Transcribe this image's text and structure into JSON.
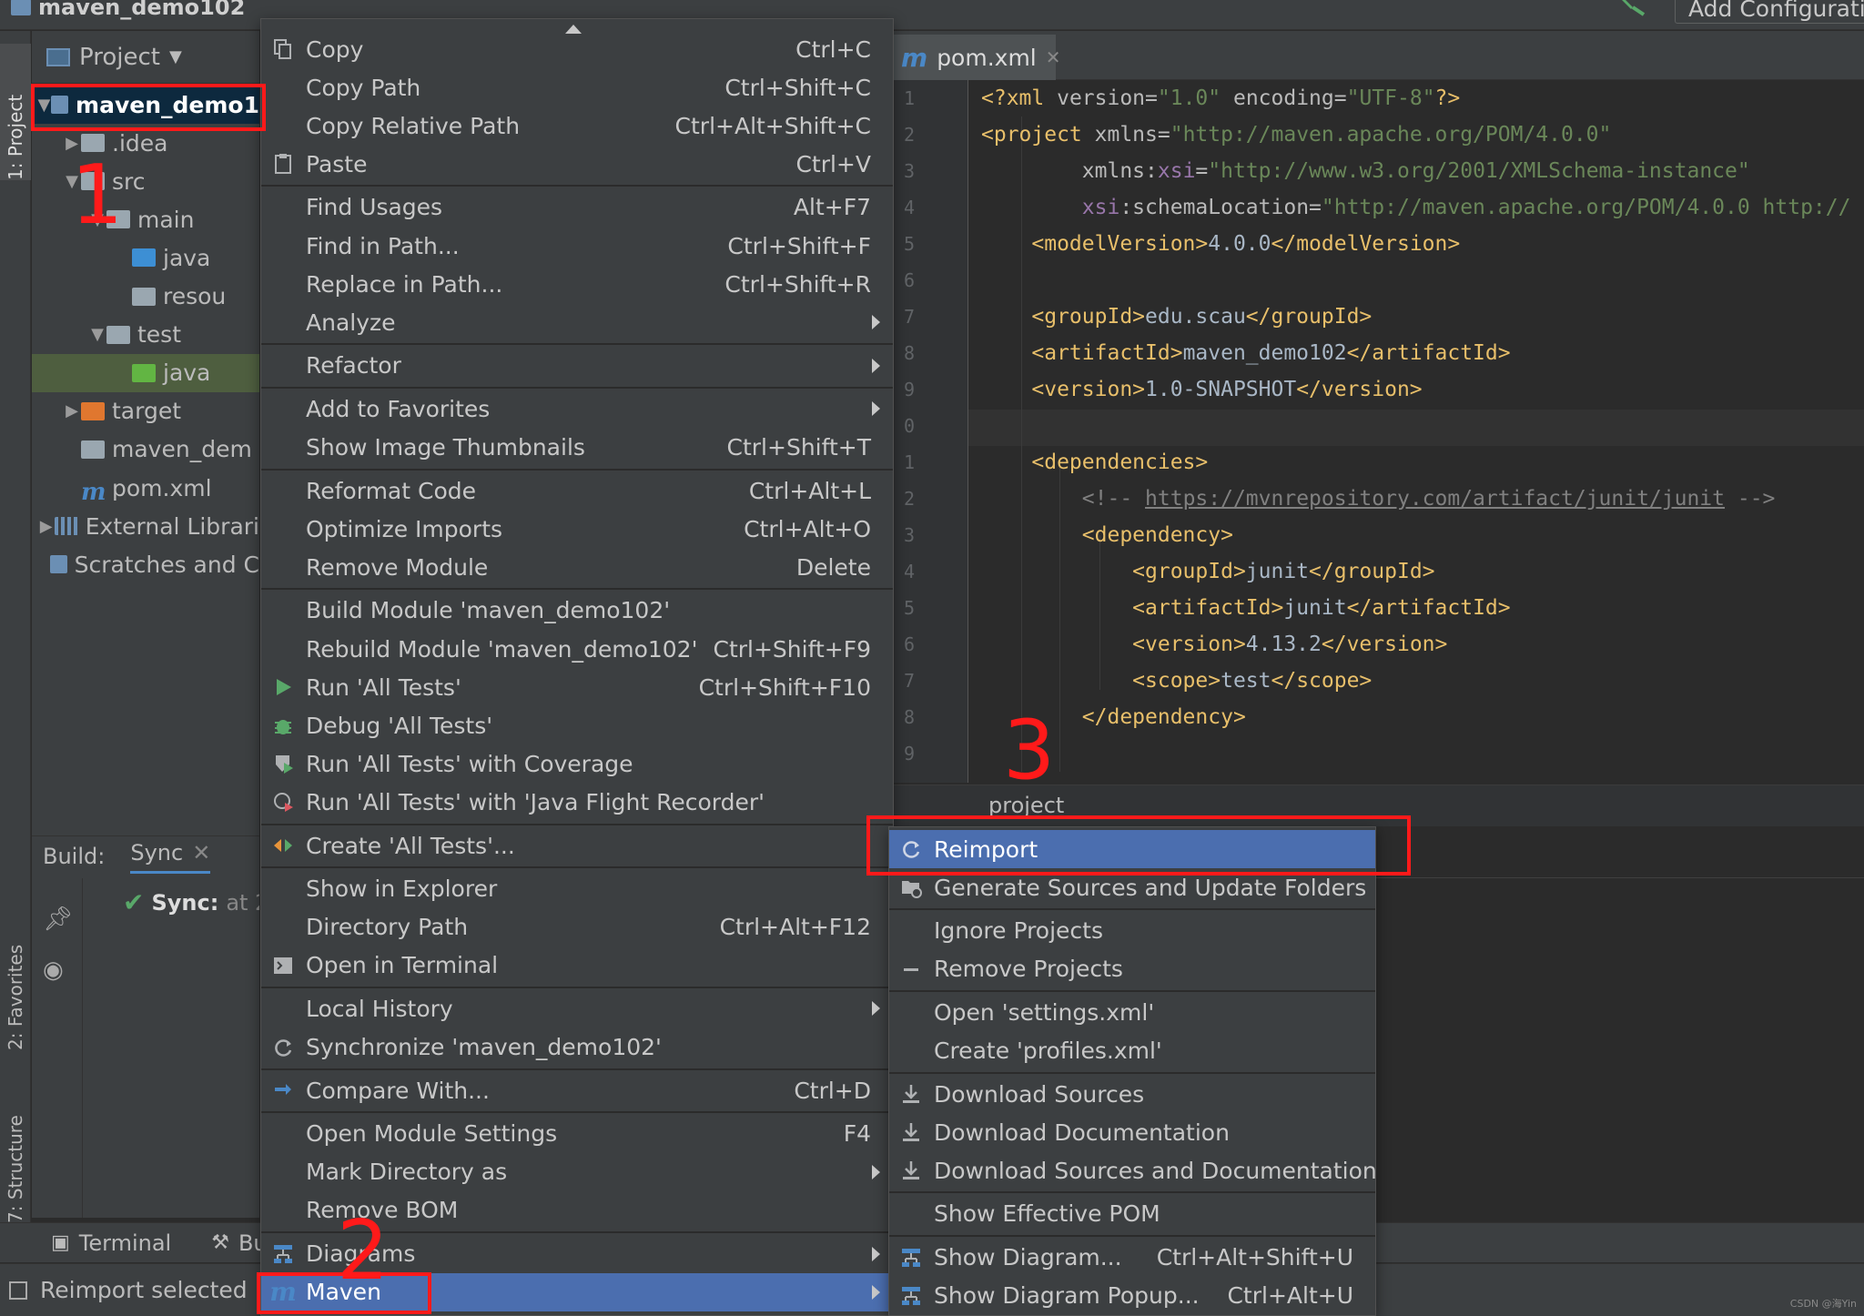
{
  "app": {
    "project_title": "maven_demo102",
    "add_config_label": "Add Configuratio"
  },
  "left_strip": {
    "project_tab": "1: Project",
    "favorites_tab": "2: Favorites",
    "structure_tab": "7: Structure"
  },
  "project_panel": {
    "header": "Project",
    "tree": [
      {
        "label": "maven_demo1",
        "indent": 0,
        "arrow": "▼",
        "icon": "module-folder-icon",
        "selected": true
      },
      {
        "label": ".idea",
        "indent": 1,
        "arrow": "▶",
        "icon": "folder-icon"
      },
      {
        "label": "src",
        "indent": 1,
        "arrow": "▼",
        "icon": "folder-icon"
      },
      {
        "label": "main",
        "indent": 2,
        "arrow": "▼",
        "icon": "folder-icon"
      },
      {
        "label": "java",
        "indent": 3,
        "arrow": "",
        "icon": "source-folder-icon"
      },
      {
        "label": "resou",
        "indent": 3,
        "arrow": "",
        "icon": "resources-folder-icon"
      },
      {
        "label": "test",
        "indent": 2,
        "arrow": "▼",
        "icon": "folder-icon"
      },
      {
        "label": "java",
        "indent": 3,
        "arrow": "",
        "icon": "test-folder-icon",
        "highlight": true
      },
      {
        "label": "target",
        "indent": 1,
        "arrow": "▶",
        "icon": "excluded-folder-icon"
      },
      {
        "label": "maven_dem",
        "indent": 1,
        "arrow": "",
        "icon": "iml-file-icon"
      },
      {
        "label": "pom.xml",
        "indent": 1,
        "arrow": "",
        "icon": "maven-file-icon"
      },
      {
        "label": "External Librari",
        "indent": 0,
        "arrow": "▶",
        "icon": "libraries-icon"
      },
      {
        "label": "Scratches and C",
        "indent": 0,
        "arrow": "",
        "icon": "scratches-icon"
      }
    ]
  },
  "build_panel": {
    "label": "Build:",
    "tab": "Sync",
    "sync_label": "Sync:",
    "sync_text": "at 2"
  },
  "bottom_bar": {
    "terminal": "Terminal",
    "build": "Bu"
  },
  "status_bar": {
    "text": "Reimport selected M"
  },
  "editor": {
    "tab_label": "pom.xml",
    "line_numbers": [
      "1",
      "2",
      "3",
      "4",
      "5",
      "6",
      "7",
      "8",
      "9",
      "0",
      "1",
      "2",
      "3",
      "4",
      "5",
      "6",
      "7",
      "8",
      "9"
    ],
    "breadcrumb": "project"
  },
  "context_menu": {
    "items": [
      {
        "label": "Copy",
        "shortcut": "Ctrl+C",
        "icon": "copy-icon"
      },
      {
        "label": "Copy Path",
        "shortcut": "Ctrl+Shift+C"
      },
      {
        "label": "Copy Relative Path",
        "shortcut": "Ctrl+Alt+Shift+C"
      },
      {
        "label": "Paste",
        "shortcut": "Ctrl+V",
        "icon": "paste-icon",
        "sep_after": true
      },
      {
        "label": "Find Usages",
        "shortcut": "Alt+F7"
      },
      {
        "label": "Find in Path...",
        "shortcut": "Ctrl+Shift+F"
      },
      {
        "label": "Replace in Path...",
        "shortcut": "Ctrl+Shift+R"
      },
      {
        "label": "Analyze",
        "submenu": true,
        "sep_after": true
      },
      {
        "label": "Refactor",
        "submenu": true,
        "sep_after": true
      },
      {
        "label": "Add to Favorites",
        "submenu": true
      },
      {
        "label": "Show Image Thumbnails",
        "shortcut": "Ctrl+Shift+T",
        "sep_after": true
      },
      {
        "label": "Reformat Code",
        "shortcut": "Ctrl+Alt+L"
      },
      {
        "label": "Optimize Imports",
        "shortcut": "Ctrl+Alt+O"
      },
      {
        "label": "Remove Module",
        "shortcut": "Delete",
        "sep_after": true
      },
      {
        "label": "Build Module 'maven_demo102'"
      },
      {
        "label": "Rebuild Module 'maven_demo102'",
        "shortcut": "Ctrl+Shift+F9"
      },
      {
        "label": "Run 'All Tests'",
        "shortcut": "Ctrl+Shift+F10",
        "icon": "run-icon"
      },
      {
        "label": "Debug 'All Tests'",
        "icon": "debug-icon"
      },
      {
        "label": "Run 'All Tests' with Coverage",
        "icon": "coverage-icon"
      },
      {
        "label": "Run 'All Tests' with 'Java Flight Recorder'",
        "icon": "profiler-icon",
        "sep_after": true
      },
      {
        "label": "Create 'All Tests'...",
        "icon": "create-config-icon",
        "sep_after": true
      },
      {
        "label": "Show in Explorer"
      },
      {
        "label": "Directory Path",
        "shortcut": "Ctrl+Alt+F12"
      },
      {
        "label": "Open in Terminal",
        "icon": "terminal-icon",
        "sep_after": true
      },
      {
        "label": "Local History",
        "submenu": true
      },
      {
        "label": "Synchronize 'maven_demo102'",
        "icon": "sync-icon",
        "sep_after": true
      },
      {
        "label": "Compare With...",
        "shortcut": "Ctrl+D",
        "icon": "compare-icon",
        "sep_after": true
      },
      {
        "label": "Open Module Settings",
        "shortcut": "F4"
      },
      {
        "label": "Mark Directory as",
        "submenu": true
      },
      {
        "label": "Remove BOM",
        "sep_after": true
      },
      {
        "label": "Diagrams",
        "submenu": true,
        "icon": "diagram-icon"
      },
      {
        "label": "Maven",
        "submenu": true,
        "icon": "maven-icon",
        "active": true
      }
    ]
  },
  "maven_submenu": {
    "items": [
      {
        "label": "Reimport",
        "icon": "reimport-icon",
        "active": true
      },
      {
        "label": "Generate Sources and Update Folders",
        "icon": "generate-sources-icon",
        "sep_after": true
      },
      {
        "label": "Ignore Projects"
      },
      {
        "label": "Remove Projects",
        "icon": "minus-icon",
        "sep_after": true
      },
      {
        "label": "Open 'settings.xml'"
      },
      {
        "label": "Create 'profiles.xml'",
        "sep_after": true
      },
      {
        "label": "Download Sources",
        "icon": "download-icon"
      },
      {
        "label": "Download Documentation",
        "icon": "download-icon"
      },
      {
        "label": "Download Sources and Documentation",
        "icon": "download-icon",
        "sep_after": true
      },
      {
        "label": "Show Effective POM",
        "sep_after": true
      },
      {
        "label": "Show Diagram...",
        "shortcut": "Ctrl+Alt+Shift+U",
        "icon": "diagram-icon"
      },
      {
        "label": "Show Diagram Popup...",
        "shortcut": "Ctrl+Alt+U",
        "icon": "diagram-icon"
      }
    ]
  },
  "annotations": {
    "n1": "1",
    "n2": "2",
    "n3": "3"
  },
  "watermark": "CSDN @海Yin",
  "colors": {
    "menu_bg": "#3c3f41",
    "menu_active": "#4b6eaf",
    "annotation_red": "#ff1a1a",
    "xml_tag": "#e8bf6a",
    "xml_value": "#6a8759"
  }
}
